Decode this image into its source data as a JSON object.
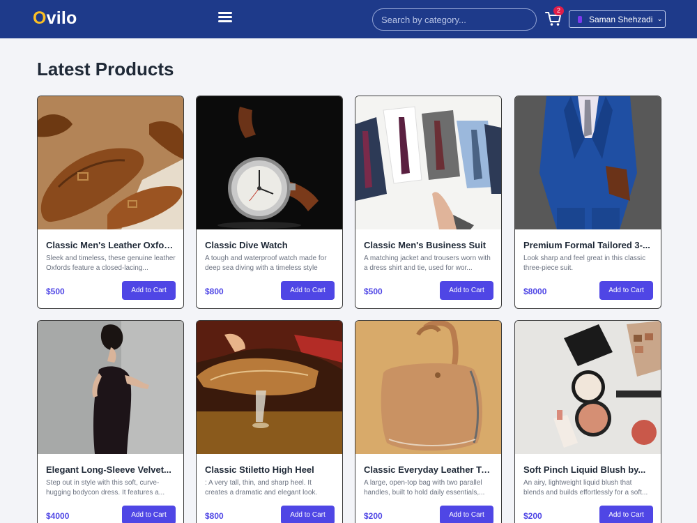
{
  "header": {
    "logo_first": "O",
    "logo_rest": "vilo",
    "search_placeholder": "Search by category...",
    "cart_count": "2",
    "user_name": "Saman Shehzadi",
    "menu_icon": "hamburger-icon",
    "cart_icon": "cart-icon"
  },
  "colors": {
    "header_bg": "#1e3a8a",
    "accent": "#4f46e5",
    "logo_accent": "#fbbf24",
    "badge": "#e11d48"
  },
  "main": {
    "heading": "Latest Products",
    "button_label": "Add to Cart"
  },
  "products": [
    {
      "title": "Classic Men's Leather Oxford...",
      "desc": "Sleek and timeless, these genuine leather Oxfords feature a closed-lacing...",
      "price": "$500",
      "image": "brown leather oxford shoes"
    },
    {
      "title": "Classic Dive Watch",
      "desc": "A tough and waterproof watch made for deep sea diving with a timeless style",
      "price": "$800",
      "image": "dive watch on black"
    },
    {
      "title": "Classic Men's Business Suit",
      "desc": "A matching jacket and trousers worn with a dress shirt and tie, used for wor...",
      "price": "$500",
      "image": "folded shirts and ties"
    },
    {
      "title": "Premium Formal Tailored 3-...",
      "desc": "Look sharp and feel great in this classic three-piece suit.",
      "price": "$8000",
      "image": "man in blue suit"
    },
    {
      "title": "Elegant Long-Sleeve Velvet...",
      "desc": "Step out in style with this soft, curve-hugging bodycon dress. It features a...",
      "price": "$4000",
      "image": "woman in black dress"
    },
    {
      "title": "Classic Stiletto High Heel",
      "desc": ": A very tall, thin, and sharp heel. It creates a dramatic and elegant look.",
      "price": "$800",
      "image": "embroidered high heel"
    },
    {
      "title": "Classic Everyday Leather Tote",
      "desc": "A large, open-top bag with two parallel handles, built to hold daily essentials,...",
      "price": "$200",
      "image": "tan leather tote bag"
    },
    {
      "title": "Soft Pinch Liquid Blush by...",
      "desc": "An airy, lightweight liquid blush that blends and builds effortlessly for a soft...",
      "price": "$200",
      "image": "makeup products flatlay"
    }
  ]
}
